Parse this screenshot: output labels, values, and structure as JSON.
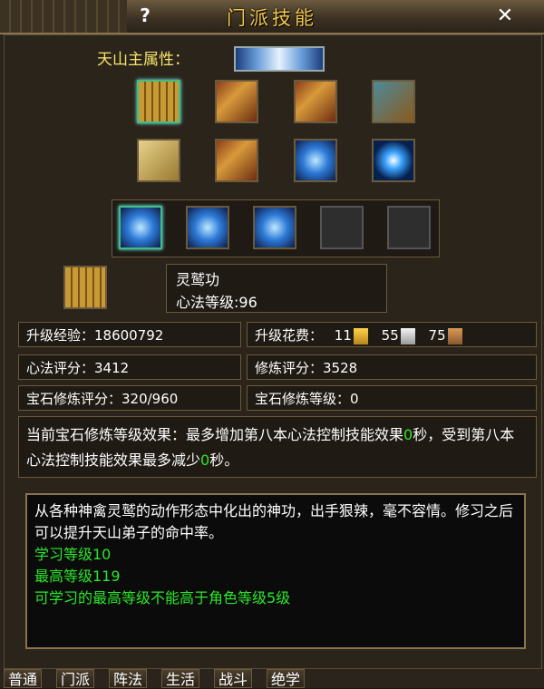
{
  "window": {
    "title": "门派技能",
    "help_symbol": "?",
    "close_symbol": "✕"
  },
  "attribute": {
    "label": "天山主属性："
  },
  "icons_row1": [
    {
      "name": "scroll-book-icon",
      "style": "scroll"
    },
    {
      "name": "red-book-icon",
      "style": "book"
    },
    {
      "name": "gold-book-icon",
      "style": "book"
    },
    {
      "name": "teal-book-icon",
      "style": "teal"
    }
  ],
  "icons_row2": [
    {
      "name": "yellow-card-icon",
      "style": "card"
    },
    {
      "name": "silver-box-icon",
      "style": "book"
    },
    {
      "name": "blue-tome-icon",
      "style": "blue"
    },
    {
      "name": "galaxy-orb-icon",
      "style": "galaxy"
    }
  ],
  "skills": [
    {
      "name": "fist-skill-icon",
      "style": "blue"
    },
    {
      "name": "light-pillar-skill-icon",
      "style": "blue"
    },
    {
      "name": "rune-skill-icon",
      "style": "blue"
    },
    {
      "name": "empty-skill-slot",
      "style": "empty"
    },
    {
      "name": "empty-skill-slot",
      "style": "empty"
    }
  ],
  "selected_skill": {
    "name": "灵鹫功",
    "level_line": "心法等级:96"
  },
  "stats": {
    "upgrade_exp": "升级经验：18600792",
    "upgrade_cost_label": "升级花费：",
    "cost_gold": "11",
    "cost_silver": "55",
    "cost_copper": "75",
    "xinfa_score": "心法评分：3412",
    "xiulian_score": "修炼评分：3528",
    "gem_score": "宝石修炼评分：320/960",
    "gem_level": "宝石修炼等级：0"
  },
  "effect": {
    "part1": "当前宝石修炼等级效果：最多增加第八本心法控制技能效果",
    "val1": "0",
    "part2": "秒，受到第八本心法控制技能效果最多减少",
    "val2": "0",
    "part3": "秒。"
  },
  "description": {
    "text": "从各种神禽灵鹫的动作形态中化出的神功，出手狠辣，毫不容情。修习之后可以提升天山弟子的命中率。",
    "learn_level": "学习等级10",
    "max_level": "最高等级119",
    "limit": "可学习的最高等级不能高于角色等级5级"
  },
  "tabs": [
    "普通",
    "门派",
    "阵法",
    "生活",
    "战斗",
    "绝学"
  ]
}
